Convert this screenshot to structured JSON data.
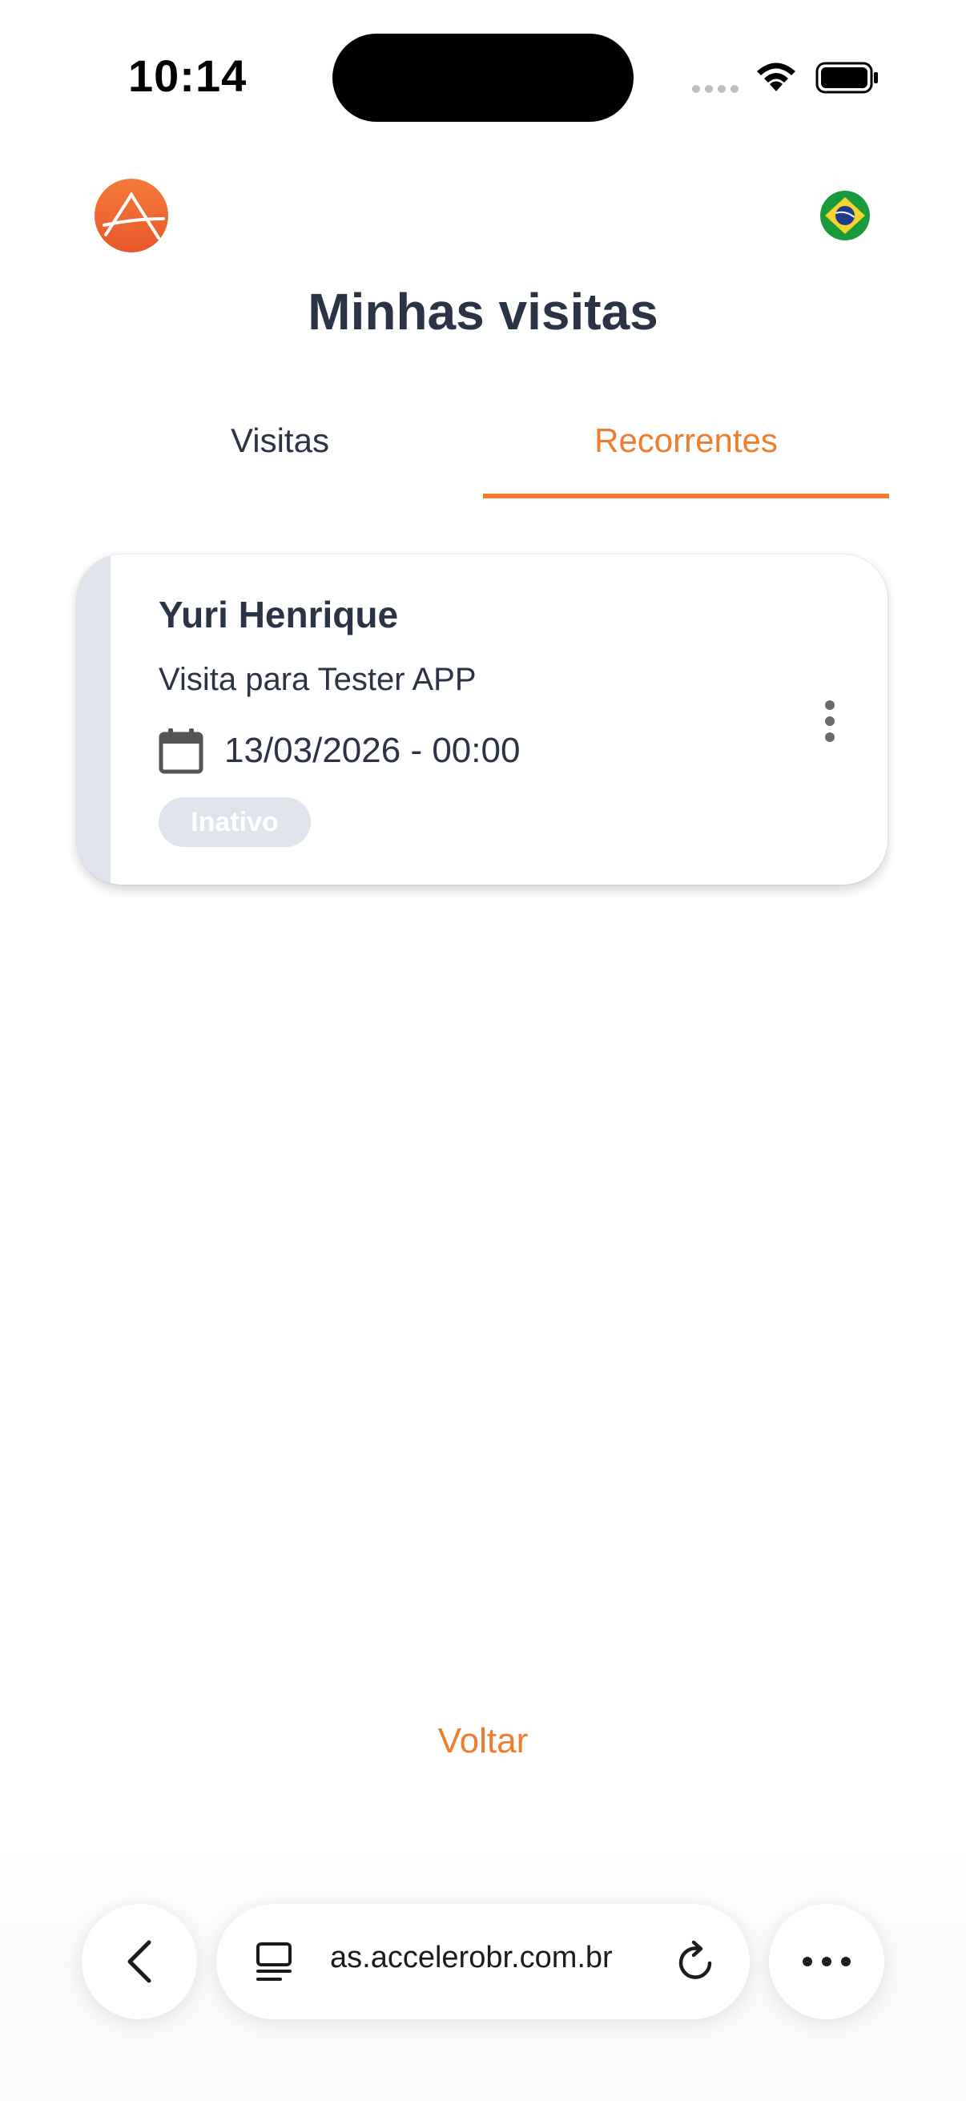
{
  "status_bar": {
    "time": "10:14"
  },
  "header": {
    "logo_icon": "accelero-logo-icon",
    "language_flag": "brazil-flag-icon",
    "title": "Minhas visitas"
  },
  "tabs": [
    {
      "label": "Visitas",
      "active": false
    },
    {
      "label": "Recorrentes",
      "active": true
    }
  ],
  "visits": [
    {
      "name": "Yuri Henrique",
      "description": "Visita para Tester APP",
      "datetime": "13/03/2026 - 00:00",
      "status": "Inativo"
    }
  ],
  "footer": {
    "back_label": "Voltar"
  },
  "browser": {
    "url": "as.accelerobr.com.br"
  },
  "colors": {
    "accent": "#ee7d2f",
    "text": "#2b3346",
    "inactive_badge": "#dee3ec"
  }
}
